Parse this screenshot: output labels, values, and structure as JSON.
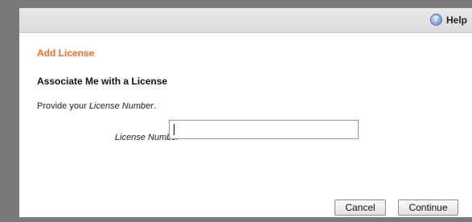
{
  "header": {
    "help_label": "Help",
    "help_icon": "help-icon"
  },
  "dialog": {
    "title": "Add License",
    "heading": "Associate Me with a License",
    "description_prefix": "Provide your ",
    "description_em": "License Number",
    "description_suffix": "."
  },
  "form": {
    "license_label": "License Number",
    "license_value": ""
  },
  "buttons": {
    "cancel": "Cancel",
    "continue": "Continue"
  },
  "colors": {
    "title": "#f26c2a",
    "backdrop": "#7a7a7a"
  }
}
